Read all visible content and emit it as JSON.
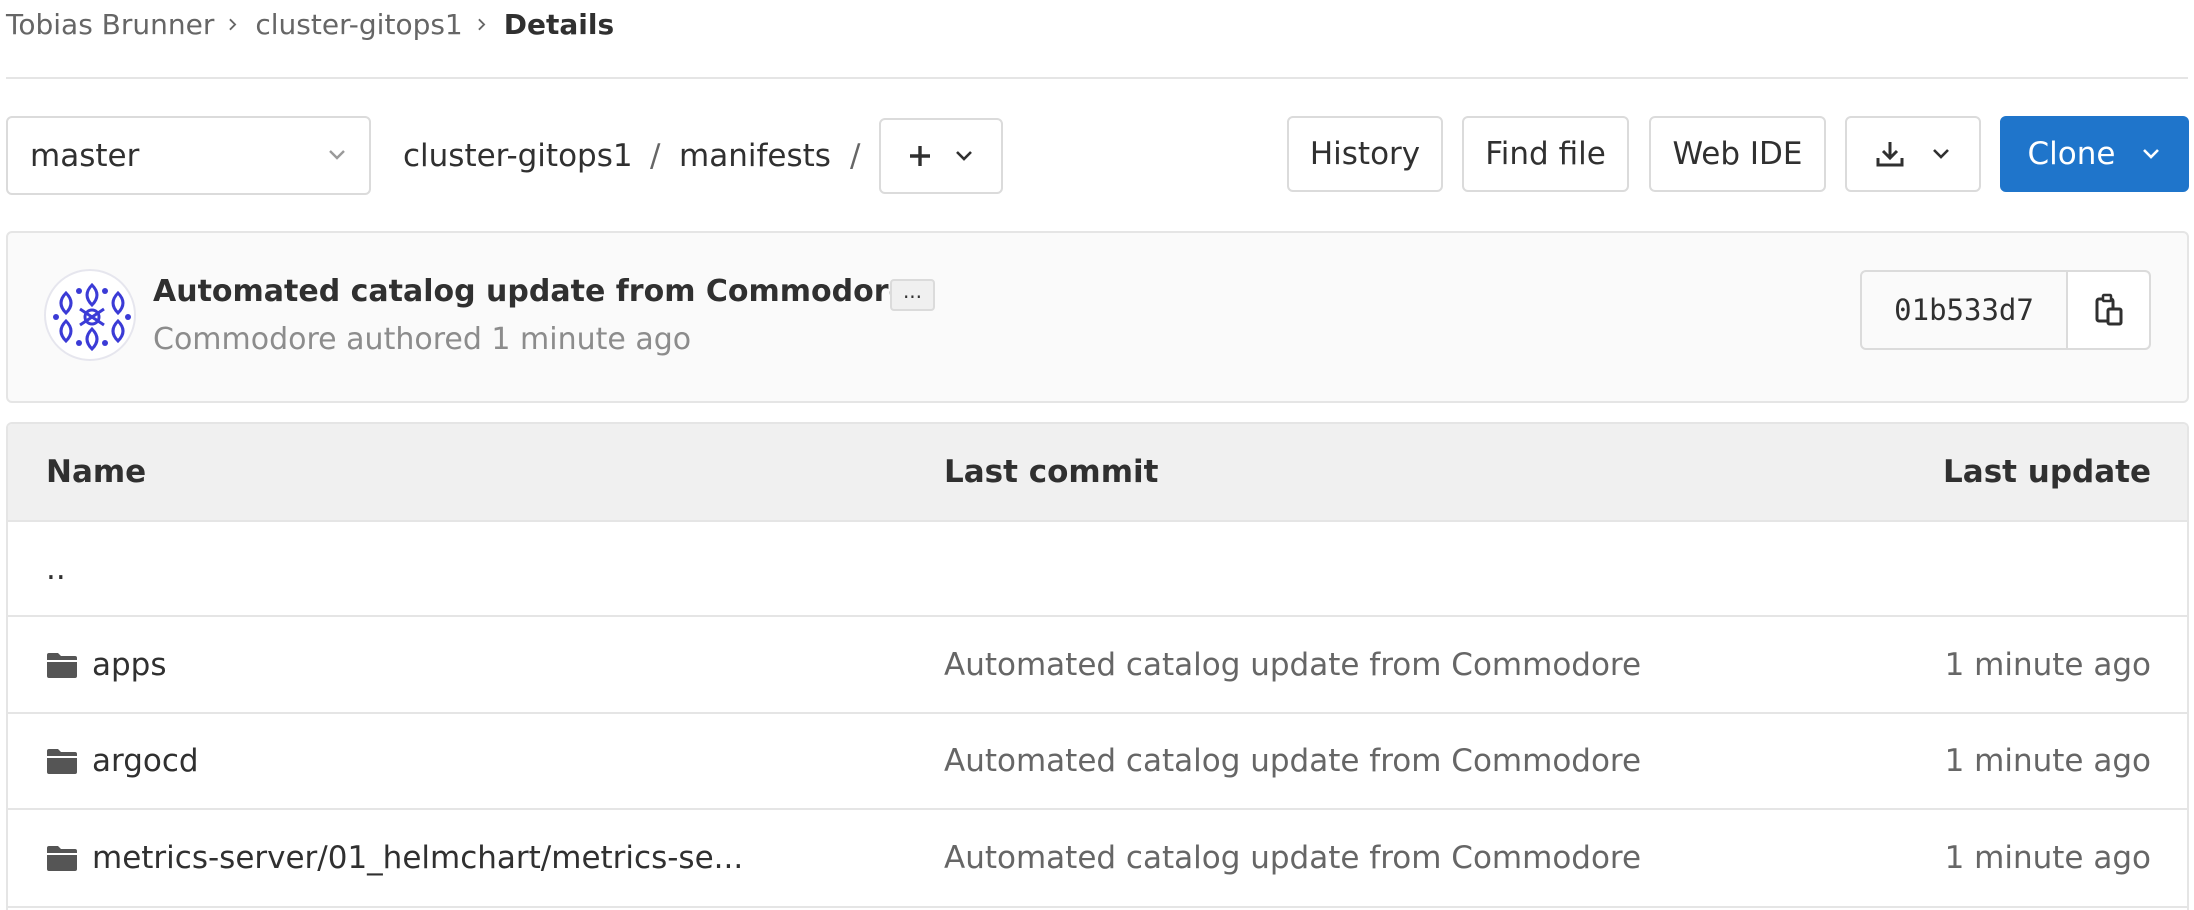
{
  "breadcrumb": {
    "items": [
      "Tobias Brunner",
      "cluster-gitops1"
    ],
    "current": "Details"
  },
  "toolbar": {
    "branch": "master",
    "path": [
      "cluster-gitops1",
      "manifests"
    ],
    "path_separator": "/",
    "add_label": "+",
    "history": "History",
    "find_file": "Find file",
    "web_ide": "Web IDE",
    "clone": "Clone"
  },
  "commit": {
    "title": "Automated catalog update from Commodore",
    "ellipsis": "...",
    "meta": "Commodore authored 1 minute ago",
    "sha": "01b533d7"
  },
  "table": {
    "headers": {
      "name": "Name",
      "last_commit": "Last commit",
      "last_update": "Last update"
    },
    "parent": "..",
    "rows": [
      {
        "name": "apps",
        "commit": "Automated catalog update from Commodore",
        "updated": "1 minute ago"
      },
      {
        "name": "argocd",
        "commit": "Automated catalog update from Commodore",
        "updated": "1 minute ago"
      },
      {
        "name": "metrics-server/01_helmchart/metrics-se...",
        "commit": "Automated catalog update from Commodore",
        "updated": "1 minute ago"
      }
    ]
  },
  "colors": {
    "primary": "#1f75cb",
    "border": "#dbdbdb",
    "header_bg": "#f0f0f0",
    "avatar_pattern": "#3b3bd6"
  },
  "icons": {
    "breadcrumb_separator": "chevron-right-icon",
    "dropdown": "chevron-down-icon",
    "download": "download-icon",
    "copy": "copy-icon",
    "folder": "folder-icon"
  }
}
